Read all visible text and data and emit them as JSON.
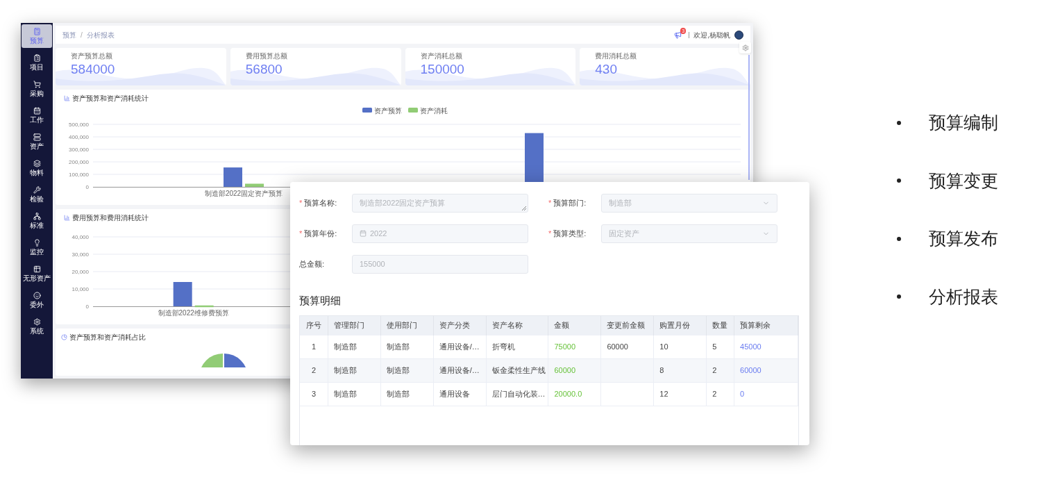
{
  "dashboard": {
    "sidebar": {
      "items": [
        {
          "label": "预算",
          "selected": true
        },
        {
          "label": "项目",
          "selected": false
        },
        {
          "label": "采购",
          "selected": false
        },
        {
          "label": "工作",
          "selected": false
        },
        {
          "label": "资产",
          "selected": false
        },
        {
          "label": "物料",
          "selected": false
        },
        {
          "label": "检验",
          "selected": false
        },
        {
          "label": "标准",
          "selected": false
        },
        {
          "label": "监控",
          "selected": false
        },
        {
          "label": "无形资产",
          "selected": false
        },
        {
          "label": "委外",
          "selected": false
        },
        {
          "label": "系统",
          "selected": false
        }
      ]
    },
    "breadcrumb": [
      "预算",
      "分析报表"
    ],
    "breadcrumb_separator": "/",
    "header": {
      "notification_count": "3",
      "greeting": "欢迎,杨聪帆"
    },
    "stats": [
      {
        "label": "资产预算总额",
        "value": "584000"
      },
      {
        "label": "费用预算总额",
        "value": "56800"
      },
      {
        "label": "资产消耗总额",
        "value": "150000"
      },
      {
        "label": "费用消耗总额",
        "value": "430"
      }
    ],
    "charts": [
      {
        "title": "资产预算和资产消耗统计",
        "chart_data": {
          "type": "bar",
          "grid": true,
          "legend": true,
          "categories": [
            "制造部2022固定资产预算",
            null
          ],
          "series": [
            {
              "name": "资产预算",
              "color": "#5470c6",
              "values": [
                155000,
                430000
              ]
            },
            {
              "name": "资产消耗",
              "color": "#91cc75",
              "values": [
                25000,
                null
              ]
            }
          ],
          "ylim": [
            0,
            500000
          ],
          "yticks": [
            {
              "value": 0,
              "label": "0"
            },
            {
              "value": 100000,
              "label": "100,000"
            },
            {
              "value": 200000,
              "label": "200,000"
            },
            {
              "value": 300000,
              "label": "300,000"
            },
            {
              "value": 400000,
              "label": "400,000"
            },
            {
              "value": 500000,
              "label": "500,000"
            }
          ]
        }
      },
      {
        "title": "费用预算和费用消耗统计",
        "chart_data": {
          "type": "bar",
          "grid": true,
          "categories": [
            "制造部2022维修费预算",
            null,
            null
          ],
          "series": [
            {
              "color": "#5470c6",
              "values": [
                14000,
                null,
                null
              ]
            },
            {
              "color": "#91cc75",
              "values": [
                500,
                null,
                null
              ]
            }
          ],
          "ylim": [
            0,
            40000
          ],
          "yticks": [
            {
              "value": 0,
              "label": "0"
            },
            {
              "value": 10000,
              "label": "10,000"
            },
            {
              "value": 20000,
              "label": "20,000"
            },
            {
              "value": 30000,
              "label": "30,000"
            },
            {
              "value": 40000,
              "label": "40,000"
            }
          ]
        }
      }
    ],
    "pie_panel": {
      "title": "资产预算和资产消耗占比"
    }
  },
  "budget_form": {
    "required_mark": "*",
    "fields": [
      {
        "label": "预算名称:",
        "required": true,
        "kind": "textarea",
        "value": "制造部2022固定资产预算"
      },
      {
        "label": "预算部门:",
        "required": true,
        "kind": "select",
        "value": "制造部"
      },
      {
        "label": "预算年份:",
        "required": true,
        "kind": "date",
        "value": "2022"
      },
      {
        "label": "预算类型:",
        "required": true,
        "kind": "select",
        "value": "固定资产"
      },
      {
        "label": "总金额:",
        "required": false,
        "kind": "input",
        "value": "155000"
      }
    ],
    "section_title": "预算明细",
    "table": {
      "columns": [
        "序号",
        "管理部门",
        "使用部门",
        "资产分类",
        "资产名称",
        "金额",
        "变更前金额",
        "购置月份",
        "数量",
        "预算剩余"
      ],
      "rows": [
        [
          "1",
          "制造部",
          "制造部",
          "通用设备/…",
          "折弯机",
          "75000",
          "60000",
          "10",
          "5",
          "45000"
        ],
        [
          "2",
          "制造部",
          "制造部",
          "通用设备/…",
          "钣金柔性生产线",
          "60000",
          "",
          "8",
          "2",
          "60000"
        ],
        [
          "3",
          "制造部",
          "制造部",
          "通用设备",
          "层门自动化装…",
          "20000.0",
          "",
          "12",
          "2",
          "0"
        ]
      ]
    }
  },
  "features": [
    "预算编制",
    "预算变更",
    "预算发布",
    "分析报表"
  ]
}
